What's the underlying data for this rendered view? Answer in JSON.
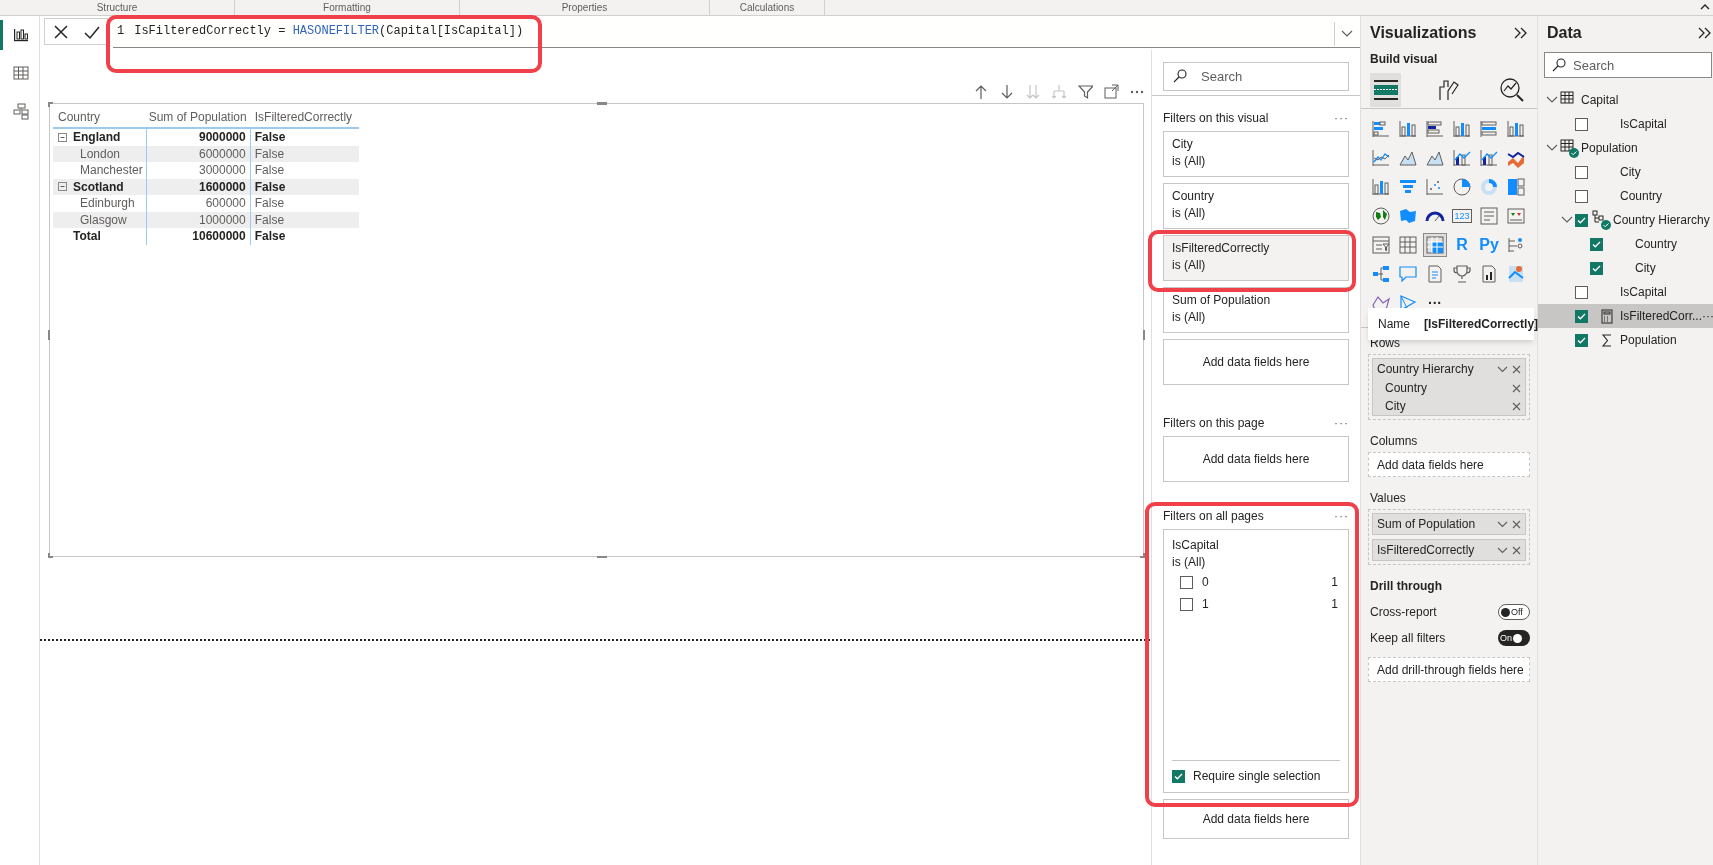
{
  "ribbon": {
    "tabs": [
      {
        "label": "Structure"
      },
      {
        "label": "Formatting"
      },
      {
        "label": "Properties"
      },
      {
        "label": "Calculations"
      }
    ]
  },
  "nav": [
    {
      "kind": "report",
      "selected": true
    },
    {
      "kind": "table",
      "selected": false
    },
    {
      "kind": "model",
      "selected": false
    }
  ],
  "formula": {
    "line_number": "1",
    "tokens": [
      {
        "kind": "plain",
        "text": "IsFilteredCorrectly = "
      },
      {
        "kind": "function",
        "text": "HASONEFILTER"
      },
      {
        "kind": "plain",
        "text": "(Capital[IsCapital])"
      }
    ]
  },
  "matrix": {
    "columns": [
      "Country",
      "Sum of Population",
      "IsFilteredCorrectly"
    ],
    "rows": [
      {
        "kind": "group",
        "label": "England",
        "expanded": true,
        "value": "9000000",
        "flag": "False"
      },
      {
        "kind": "item",
        "label": "London",
        "value": "6000000",
        "flag": "False"
      },
      {
        "kind": "item",
        "label": "Manchester",
        "value": "3000000",
        "flag": "False"
      },
      {
        "kind": "group",
        "label": "Scotland",
        "expanded": true,
        "value": "1600000",
        "flag": "False"
      },
      {
        "kind": "item",
        "label": "Edinburgh",
        "value": "600000",
        "flag": "False"
      },
      {
        "kind": "item",
        "label": "Glasgow",
        "value": "1000000",
        "flag": "False"
      },
      {
        "kind": "total",
        "label": "Total",
        "value": "10600000",
        "flag": "False"
      }
    ]
  },
  "filters": {
    "search": {
      "placeholder": "Search"
    },
    "sections": [
      {
        "title": "Filters on this visual",
        "more": "···",
        "cards": [
          {
            "kind": "filter",
            "field": "City",
            "summary": "is (All)",
            "selected": false
          },
          {
            "kind": "filter",
            "field": "Country",
            "summary": "is (All)",
            "selected": false
          },
          {
            "kind": "filter",
            "field": "IsFilteredCorrectly",
            "summary": "is (All)",
            "selected": true
          },
          {
            "kind": "filter",
            "field": "Sum of Population",
            "summary": "is (All)",
            "selected": false
          },
          {
            "kind": "add",
            "label": "Add data fields here"
          }
        ]
      },
      {
        "title": "Filters on this page",
        "more": "···",
        "cards": [
          {
            "kind": "add",
            "label": "Add data fields here"
          }
        ]
      },
      {
        "title": "Filters on all pages",
        "more": "···",
        "cards": [
          {
            "kind": "list",
            "field": "IsCapital",
            "summary": "is (All)",
            "options": [
              {
                "label": "0",
                "count": "1",
                "checked": false
              },
              {
                "label": "1",
                "count": "1",
                "checked": false
              }
            ],
            "require_single": {
              "label": "Require single selection",
              "checked": true
            }
          },
          {
            "kind": "add",
            "label": "Add data fields here"
          }
        ]
      }
    ]
  },
  "visualizations": {
    "title": "Visualizations",
    "subtitle": "Build visual",
    "build_tabs": [
      {
        "kind": "fields",
        "selected": true
      },
      {
        "kind": "format",
        "selected": false
      },
      {
        "kind": "analytics",
        "selected": false
      }
    ],
    "gallery": [
      {
        "kind": "stackedbar",
        "selected": false
      },
      {
        "kind": "stackedcolumn",
        "selected": false
      },
      {
        "kind": "clusteredbar",
        "selected": false
      },
      {
        "kind": "clusteredcolumn",
        "selected": false
      },
      {
        "kind": "fullbar",
        "selected": false
      },
      {
        "kind": "fullcolumn",
        "selected": false
      },
      {
        "kind": "line",
        "selected": false
      },
      {
        "kind": "area",
        "selected": false
      },
      {
        "kind": "stackedarea",
        "selected": false
      },
      {
        "kind": "linecolumn",
        "selected": false
      },
      {
        "kind": "lineclustered",
        "selected": false
      },
      {
        "kind": "ribbon",
        "selected": false
      },
      {
        "kind": "waterfall",
        "selected": false
      },
      {
        "kind": "funnel",
        "selected": false
      },
      {
        "kind": "scatter",
        "selected": false
      },
      {
        "kind": "pie",
        "selected": false
      },
      {
        "kind": "donut",
        "selected": false
      },
      {
        "kind": "treemap",
        "selected": false
      },
      {
        "kind": "map",
        "selected": false
      },
      {
        "kind": "filledmap",
        "selected": false
      },
      {
        "kind": "gauge",
        "selected": false
      },
      {
        "kind": "card",
        "label": "123",
        "selected": false
      },
      {
        "kind": "multicard",
        "selected": false
      },
      {
        "kind": "kpi",
        "selected": false
      },
      {
        "kind": "slicer",
        "selected": false
      },
      {
        "kind": "table",
        "selected": false
      },
      {
        "kind": "matrix",
        "selected": true
      },
      {
        "kind": "rscript",
        "label": "R",
        "selected": false
      },
      {
        "kind": "python",
        "label": "Py",
        "selected": false
      },
      {
        "kind": "influencers",
        "selected": false
      },
      {
        "kind": "decomposition",
        "selected": false
      },
      {
        "kind": "qa",
        "selected": false
      },
      {
        "kind": "narrative",
        "selected": false
      },
      {
        "kind": "goals",
        "selected": false
      },
      {
        "kind": "paginated",
        "selected": false
      },
      {
        "kind": "azuremap",
        "selected": false
      },
      {
        "kind": "shapemap",
        "selected": false
      },
      {
        "kind": "arcgis",
        "selected": false
      },
      {
        "kind": "more",
        "label": "···",
        "selected": false
      }
    ],
    "tooltip": {
      "key": "Name",
      "value": "[IsFilteredCorrectly]"
    },
    "wells": [
      {
        "title": "Rows",
        "items": [
          {
            "label": "Country Hierarchy",
            "children": [
              {
                "label": "Country"
              },
              {
                "label": "City"
              }
            ]
          }
        ]
      },
      {
        "title": "Columns",
        "placeholder": "Add data fields here"
      },
      {
        "title": "Values",
        "items": [
          {
            "label": "Sum of Population"
          },
          {
            "label": "IsFilteredCorrectly"
          }
        ]
      }
    ],
    "drill_through": {
      "title": "Drill through",
      "toggles": [
        {
          "label": "Cross-report",
          "on": false,
          "state_text": "Off"
        },
        {
          "label": "Keep all filters",
          "on": true,
          "state_text": "On"
        }
      ],
      "placeholder": "Add drill-through fields here"
    }
  },
  "data": {
    "title": "Data",
    "search": {
      "placeholder": "Search"
    },
    "tree": [
      {
        "label": "Capital",
        "kind": "table",
        "in_use": false,
        "expanded": true,
        "selected": false,
        "children": [
          {
            "label": "IsCapital",
            "checked": false,
            "selected": false
          }
        ]
      },
      {
        "label": "Population",
        "kind": "table",
        "in_use": true,
        "expanded": true,
        "selected": false,
        "children": [
          {
            "label": "City",
            "checked": false,
            "selected": false
          },
          {
            "label": "Country",
            "checked": false,
            "selected": false
          },
          {
            "label": "Country Hierarchy",
            "kind": "hierarchy",
            "in_use": true,
            "checked": true,
            "expanded": true,
            "selected": false,
            "children": [
              {
                "label": "Country",
                "checked": true,
                "selected": false
              },
              {
                "label": "City",
                "checked": true,
                "selected": false
              }
            ]
          },
          {
            "label": "IsCapital",
            "checked": false,
            "selected": false
          },
          {
            "label": "IsFilteredCorr...",
            "kind": "measure",
            "checked": true,
            "selected": true,
            "menu": "···"
          },
          {
            "label": "Population",
            "kind": "sum",
            "checked": true,
            "selected": false
          }
        ]
      }
    ]
  }
}
